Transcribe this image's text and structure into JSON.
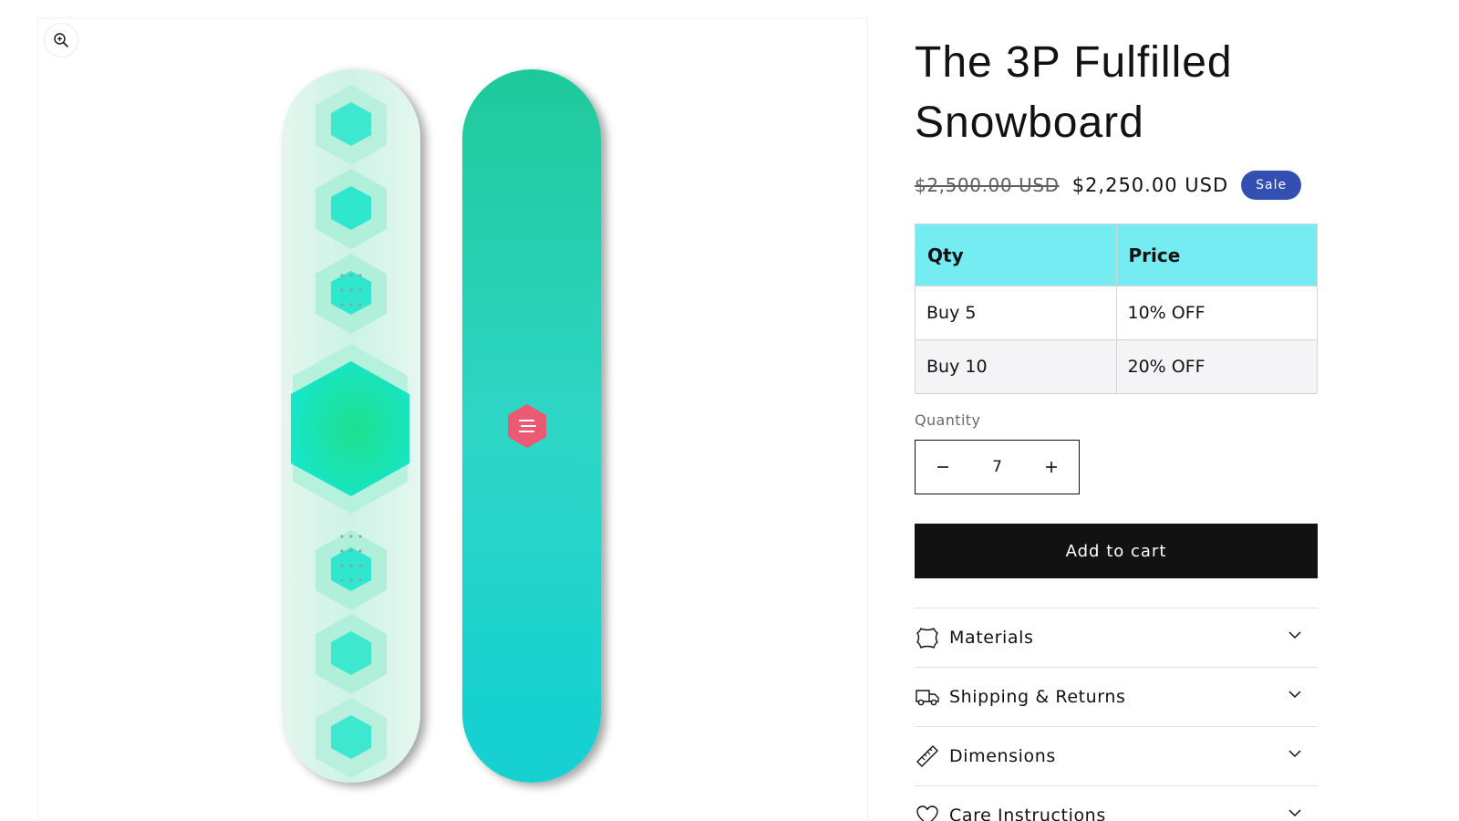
{
  "product": {
    "title": "The 3P Fulfilled Snowboard",
    "compare_price": "$2,500.00 USD",
    "sale_price": "$2,250.00 USD",
    "sale_badge": "Sale"
  },
  "media": {
    "zoom_icon": "zoom-in-icon",
    "boards": [
      "board-top-light",
      "board-base-teal"
    ]
  },
  "volume_table": {
    "headers": [
      "Qty",
      "Price"
    ],
    "rows": [
      [
        "Buy 5",
        "10% OFF"
      ],
      [
        "Buy 10",
        "20% OFF"
      ]
    ],
    "header_color": "#74ecf2"
  },
  "quantity": {
    "label": "Quantity",
    "value": "7",
    "decrease_icon": "minus-icon",
    "increase_icon": "plus-icon"
  },
  "cart": {
    "add_label": "Add to cart"
  },
  "accordion": [
    {
      "label": "Materials",
      "icon": "leather-icon"
    },
    {
      "label": "Shipping & Returns",
      "icon": "truck-icon"
    },
    {
      "label": "Dimensions",
      "icon": "ruler-icon"
    },
    {
      "label": "Care Instructions",
      "icon": "heart-icon"
    }
  ],
  "colors": {
    "badge": "#334fb4",
    "button": "#121212",
    "board_base": "#1fd6c8",
    "board_top": "#e3f7ef",
    "logo": "#e85a72"
  }
}
